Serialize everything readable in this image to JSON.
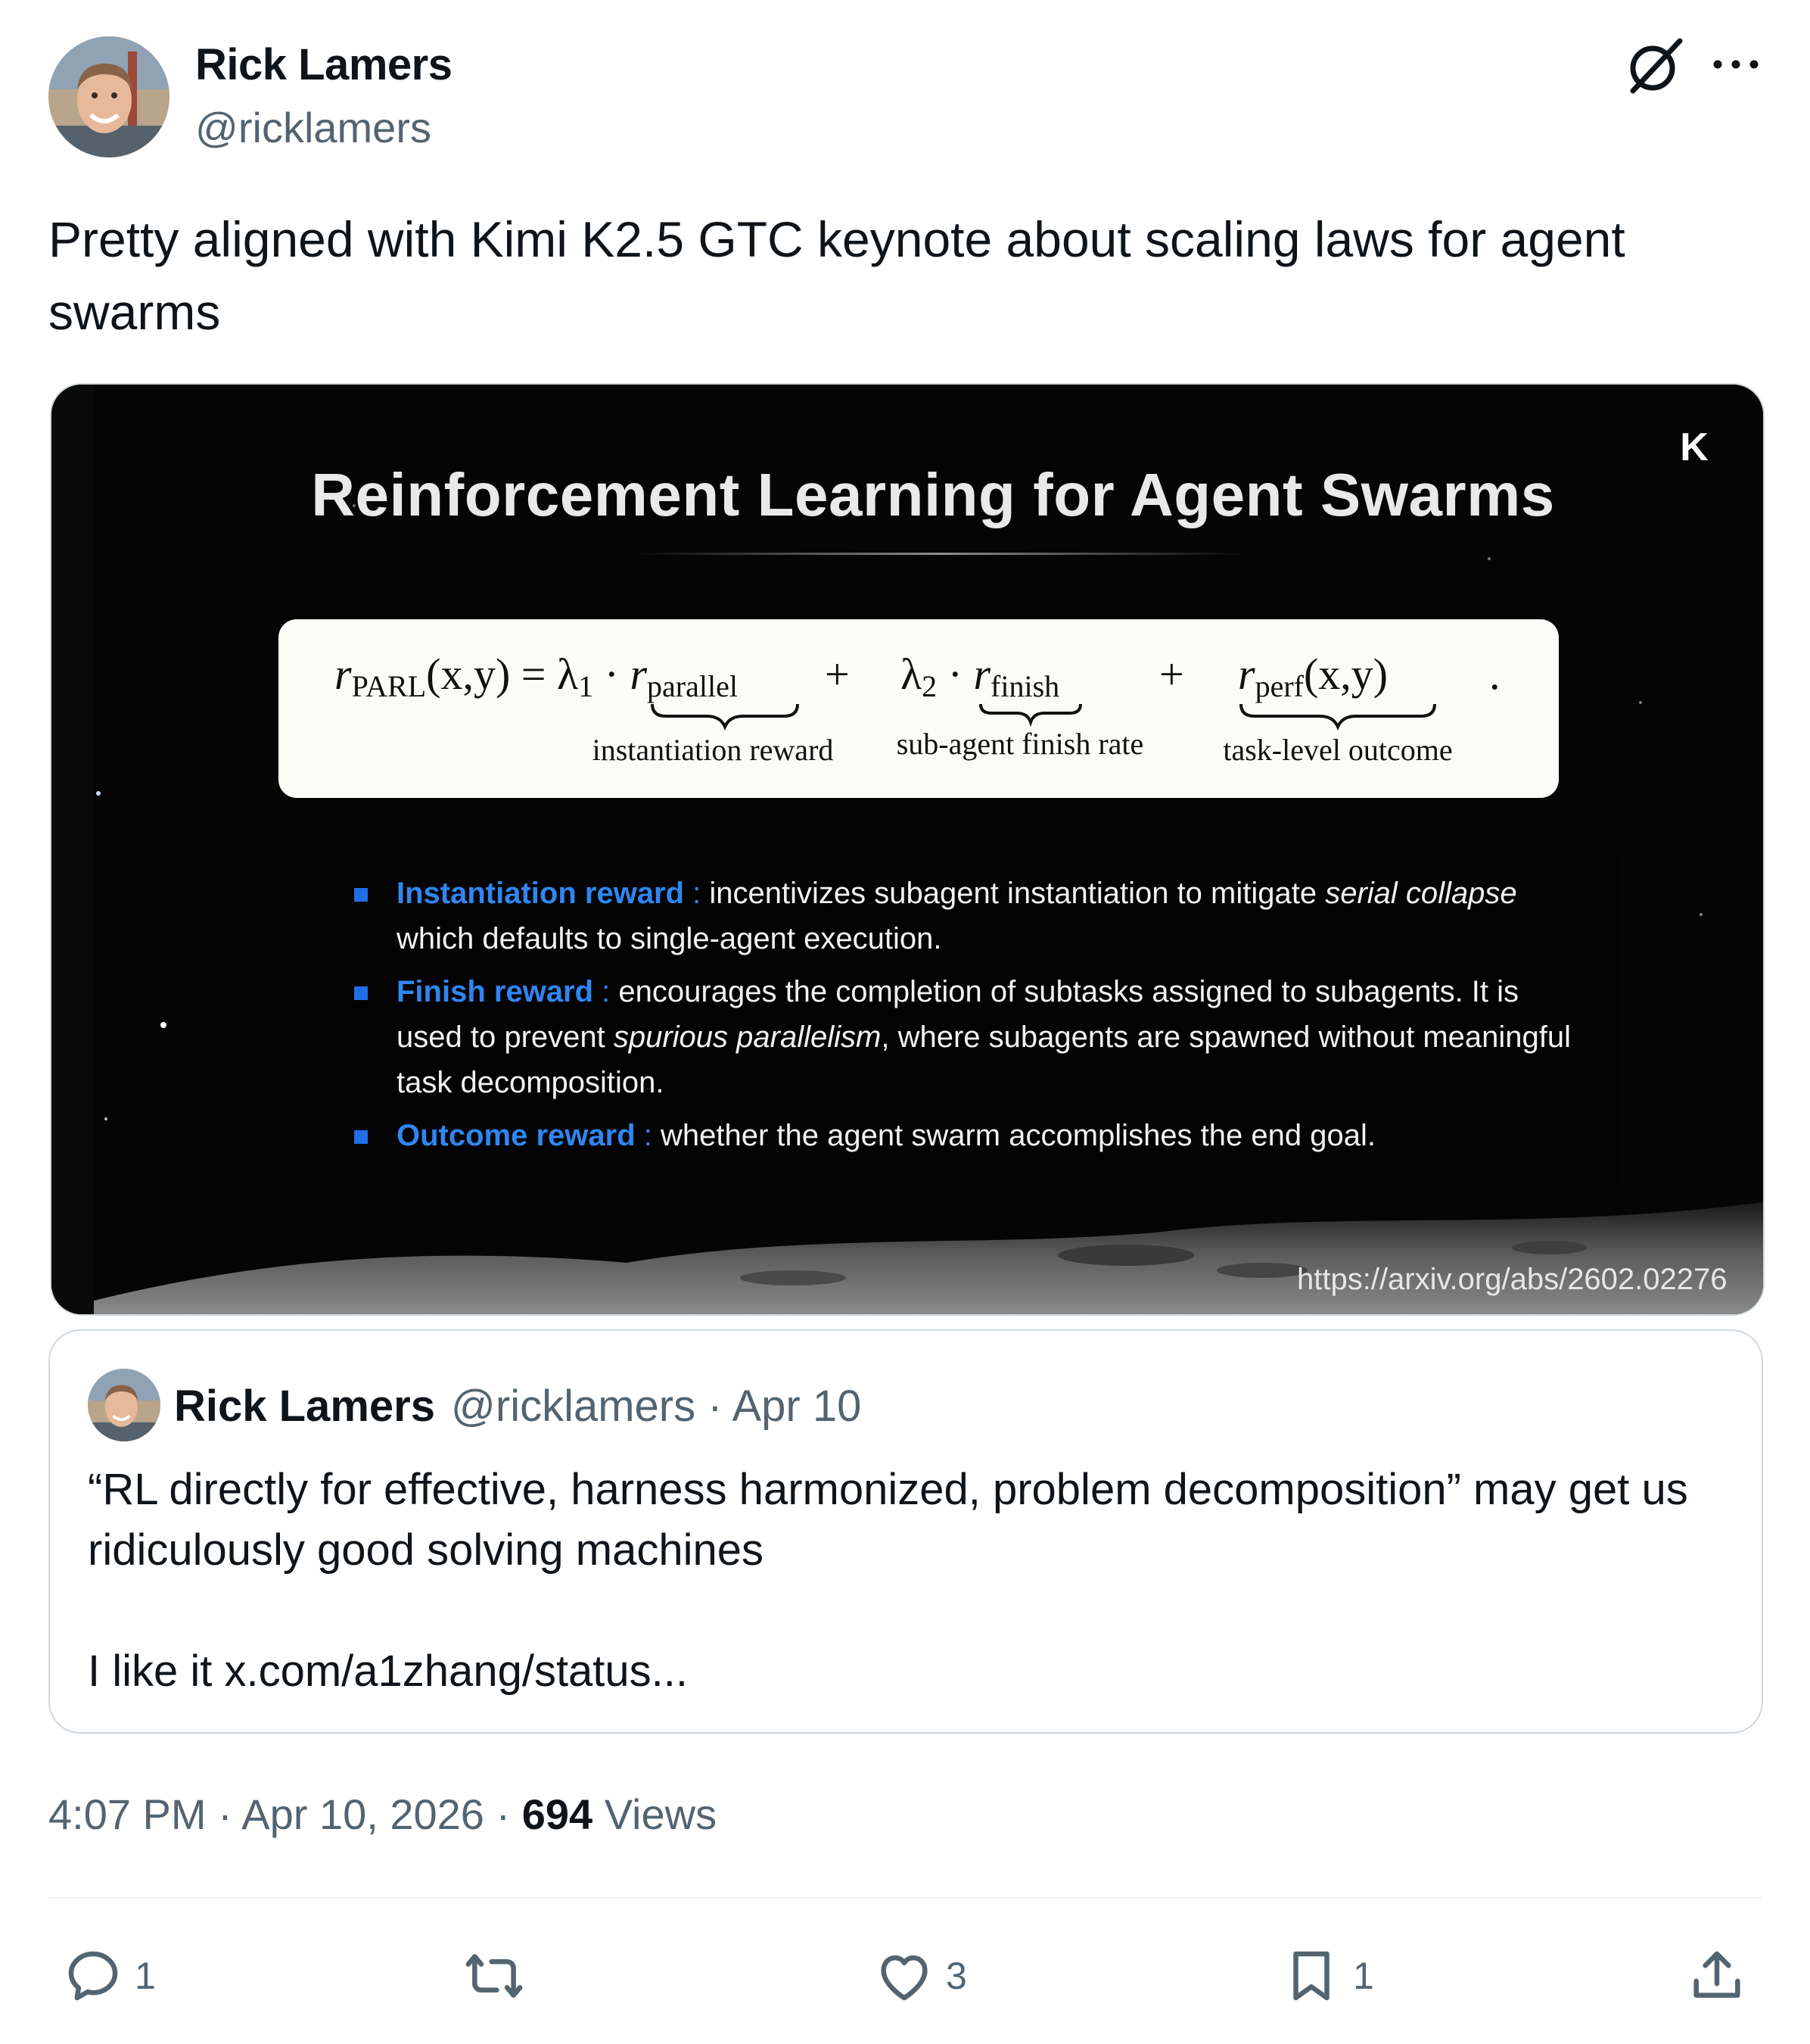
{
  "author": {
    "name": "Rick Lamers",
    "handle": "@ricklamers"
  },
  "tweet": {
    "text": "Pretty aligned with Kimi K2.5 GTC keynote about scaling laws for agent swarms"
  },
  "media": {
    "slide_title": "Reinforcement Learning for Agent Swarms",
    "logo_text": "K",
    "formula": {
      "lhs": "r",
      "lhs_sub": "PARL",
      "args": "(x,y) = λ",
      "lambda1_sub": "1",
      "term1": "r",
      "term1_sub": "parallel",
      "term2_lambda": "λ",
      "lambda2_sub": "2",
      "term2": "r",
      "term2_sub": "finish",
      "term3": "r",
      "term3_sub": "perf",
      "term3_args": "(x,y)",
      "brace_label_1": "instantiation reward",
      "brace_label_2": "sub-agent finish rate",
      "brace_label_3": "task-level outcome"
    },
    "bullets": [
      {
        "term": "Instantiation reward",
        "pre": "incentivizes subagent instantiation to mitigate ",
        "em": "serial collapse",
        "post": " which defaults to single-agent execution."
      },
      {
        "term": "Finish reward",
        "pre": "encourages the completion of subtasks assigned to subagents. It is used to prevent ",
        "em": "spurious parallelism",
        "post": ", where subagents are spawned without meaningful task decomposition."
      },
      {
        "term": "Outcome reward",
        "pre": "whether the agent swarm accomplishes the end goal.",
        "em": "",
        "post": ""
      }
    ],
    "url": "https://arxiv.org/abs/2602.02276"
  },
  "quote": {
    "name": "Rick Lamers",
    "handle": "@ricklamers",
    "date": "Apr 10",
    "text_line1": "“RL directly for effective, harness harmonized, problem decomposition” may get us ridiculously good solving machines",
    "text_line2": "I like it x.com/a1zhang/status..."
  },
  "meta": {
    "time": "4:07 PM",
    "date": "Apr 10, 2026",
    "views_count": "694",
    "views_label": "Views"
  },
  "actions": {
    "replies": "1",
    "reposts": "",
    "likes": "3",
    "bookmarks": "1"
  },
  "icons": [
    "grok-icon",
    "more-icon",
    "reply-icon",
    "repost-icon",
    "like-icon",
    "bookmark-icon",
    "share-icon"
  ],
  "colors": {
    "text": "#0f1419",
    "secondary": "#536471",
    "border": "#cfd9de",
    "slide_accent": "#2f86f2"
  }
}
